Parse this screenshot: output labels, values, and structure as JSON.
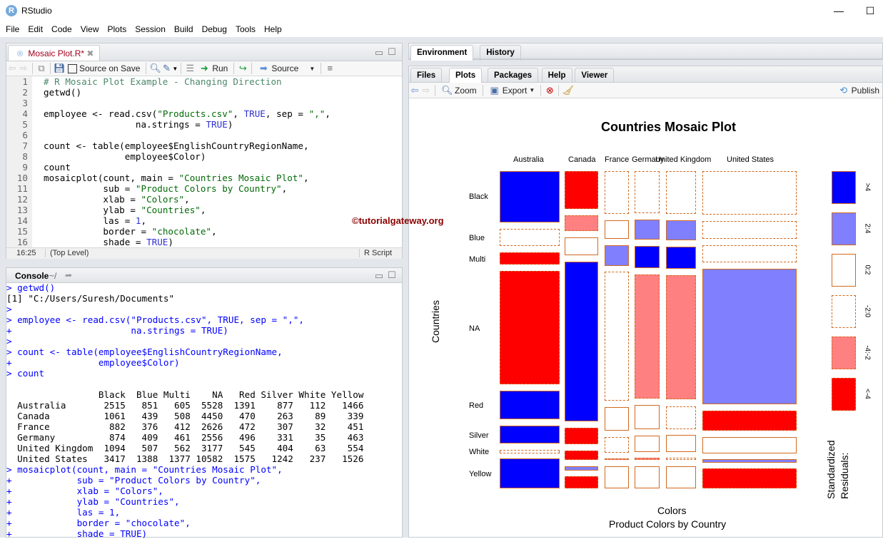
{
  "window": {
    "title": "RStudio",
    "logo": "R",
    "minimize": "—",
    "maximize": "☐"
  },
  "menu": [
    "File",
    "Edit",
    "Code",
    "View",
    "Plots",
    "Session",
    "Build",
    "Debug",
    "Tools",
    "Help"
  ],
  "editor": {
    "tab": "Mosaic Plot.R*",
    "toolbar": {
      "source_on_save": "Source on Save",
      "run": "Run",
      "source": "Source"
    },
    "lines": [
      [
        [
          "# R Mosaic Plot Example - Changing Direction",
          "c"
        ]
      ],
      [
        [
          "getwd()",
          "t"
        ]
      ],
      [
        [
          "",
          "t"
        ]
      ],
      [
        [
          "employee <- read.csv(",
          "t"
        ],
        [
          "\"Products.csv\"",
          "s"
        ],
        [
          ", ",
          "t"
        ],
        [
          "TRUE",
          "n"
        ],
        [
          ", sep = ",
          "t"
        ],
        [
          "\",\"",
          "s"
        ],
        [
          ",",
          "t"
        ]
      ],
      [
        [
          "                 na.strings = ",
          "t"
        ],
        [
          "TRUE",
          "n"
        ],
        [
          ")",
          "t"
        ]
      ],
      [
        [
          "",
          "t"
        ]
      ],
      [
        [
          "count <- table(employee$EnglishCountryRegionName,",
          "t"
        ]
      ],
      [
        [
          "               employee$Color)",
          "t"
        ]
      ],
      [
        [
          "count",
          "t"
        ]
      ],
      [
        [
          "mosaicplot(count, main = ",
          "t"
        ],
        [
          "\"Countries Mosaic Plot\"",
          "s"
        ],
        [
          ",",
          "t"
        ]
      ],
      [
        [
          "           sub = ",
          "t"
        ],
        [
          "\"Product Colors by Country\"",
          "s"
        ],
        [
          ",",
          "t"
        ]
      ],
      [
        [
          "           xlab = ",
          "t"
        ],
        [
          "\"Colors\"",
          "s"
        ],
        [
          ",",
          "t"
        ]
      ],
      [
        [
          "           ylab = ",
          "t"
        ],
        [
          "\"Countries\"",
          "s"
        ],
        [
          ",",
          "t"
        ]
      ],
      [
        [
          "           las = ",
          "t"
        ],
        [
          "1",
          "n"
        ],
        [
          ",",
          "t"
        ]
      ],
      [
        [
          "           border = ",
          "t"
        ],
        [
          "\"chocolate\"",
          "s"
        ],
        [
          ",",
          "t"
        ]
      ],
      [
        [
          "           shade = ",
          "t"
        ],
        [
          "TRUE",
          "n"
        ],
        [
          ")",
          "t"
        ]
      ]
    ],
    "status": {
      "pos": "16:25",
      "scope": "(Top Level)",
      "type": "R Script"
    }
  },
  "console": {
    "title": "Console",
    "path": "~/",
    "lines": [
      [
        "p",
        "> getwd()"
      ],
      [
        "o",
        "[1] \"C:/Users/Suresh/Documents\""
      ],
      [
        "p",
        ">"
      ],
      [
        "p",
        "> employee <- read.csv(\"Products.csv\", TRUE, sep = \",\","
      ],
      [
        "p",
        "+                      na.strings = TRUE)"
      ],
      [
        "p",
        ">"
      ],
      [
        "p",
        "> count <- table(employee$EnglishCountryRegionName,"
      ],
      [
        "p",
        "+                employee$Color)"
      ],
      [
        "p",
        "> count"
      ],
      [
        "o",
        ""
      ],
      [
        "o",
        "                 Black  Blue Multi    NA   Red Silver White Yellow"
      ],
      [
        "o",
        "  Australia       2515   851   605  5528  1391    877   112   1466"
      ],
      [
        "o",
        "  Canada          1061   439   508  4450   470    263    89    339"
      ],
      [
        "o",
        "  France           882   376   412  2626   472    307    32    451"
      ],
      [
        "o",
        "  Germany          874   409   461  2556   496    331    35    463"
      ],
      [
        "o",
        "  United Kingdom  1094   507   562  3177   545    404    63    554"
      ],
      [
        "o",
        "  United States   3417  1388  1377 10582  1575   1242   237   1526"
      ],
      [
        "p",
        "> mosaicplot(count, main = \"Countries Mosaic Plot\","
      ],
      [
        "p",
        "+            sub = \"Product Colors by Country\","
      ],
      [
        "p",
        "+            xlab = \"Colors\","
      ],
      [
        "p",
        "+            ylab = \"Countries\","
      ],
      [
        "p",
        "+            las = 1,"
      ],
      [
        "p",
        "+            border = \"chocolate\","
      ],
      [
        "p",
        "+            shade = TRUE)"
      ]
    ]
  },
  "right": {
    "top_tabs": [
      "Environment",
      "History"
    ],
    "tabs": [
      "Files",
      "Plots",
      "Packages",
      "Help",
      "Viewer"
    ],
    "active_tab": "Plots",
    "toolbar": {
      "zoom": "Zoom",
      "export": "Export",
      "publish": "Publish"
    }
  },
  "watermark": "©tutorialgateway.org",
  "plot": {
    "title": "Countries Mosaic Plot",
    "sub": "Product Colors by Country",
    "xlab": "Colors",
    "ylab": "Countries",
    "columns": [
      "Australia",
      "Canada",
      "France",
      "Germany",
      "United Kingdom",
      "United States"
    ],
    "rows": [
      "Black",
      "Blue",
      "Multi",
      "NA",
      "Red",
      "Silver",
      "White",
      "Yellow"
    ],
    "legend_title": "Standardized\nResiduals:",
    "legend": [
      {
        "label": ">4",
        "fill": "#0000ff",
        "dashed": false
      },
      {
        "label": "2:4",
        "fill": "#8080ff",
        "dashed": false
      },
      {
        "label": "0:2",
        "fill": "#ffffff",
        "dashed": false
      },
      {
        "label": "-2:0",
        "fill": "#ffffff",
        "dashed": true
      },
      {
        "label": "-4:-2",
        "fill": "#ff8080",
        "dashed": true
      },
      {
        "label": "<-4",
        "fill": "#ff0000",
        "dashed": true
      }
    ],
    "border_color": "#d2691e",
    "residual_class": [
      [
        ">4",
        "-2:0",
        "<-4",
        "<-4",
        ">4",
        ">4",
        "-2:0",
        ">4"
      ],
      [
        "<-4",
        "-4:-2",
        "0:2",
        ">4",
        "<-4",
        "<-4",
        "2:4",
        "<-4"
      ],
      [
        "-2:0",
        "0:2",
        "2:4",
        "-2:0",
        "0:2",
        "-2:0",
        "-4:-2",
        "0:2"
      ],
      [
        "-2:0",
        "2:4",
        ">4",
        "-4:-2",
        "0:2",
        "0:2",
        "-4:-2",
        "0:2"
      ],
      [
        "-2:0",
        "2:4",
        ">4",
        "-4:-2",
        "-2:0",
        "0:2",
        "-2:0",
        "0:2"
      ],
      [
        "-2:0",
        "-2:0",
        "-2:0",
        "2:4",
        "<-4",
        "0:2",
        "2:4",
        "<-4"
      ]
    ]
  }
}
